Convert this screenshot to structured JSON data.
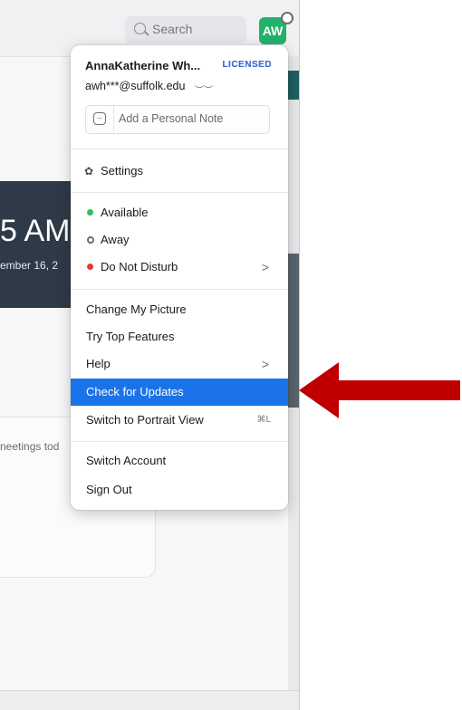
{
  "header": {
    "search_placeholder": "Search",
    "avatar_initials": "AW"
  },
  "background": {
    "clock_partial": "5 AM",
    "date_partial": "ember 16, 2",
    "meetings_partial": "neetings tod"
  },
  "menu": {
    "user_name": "AnnaKatherine Wh...",
    "license_badge": "LICENSED",
    "email": "awh***@suffolk.edu",
    "personal_note_placeholder": "Add a Personal Note",
    "settings": "Settings",
    "status": {
      "available": "Available",
      "away": "Away",
      "dnd": "Do Not Disturb",
      "dnd_chevron": ">"
    },
    "change_picture": "Change My Picture",
    "top_features": "Try Top Features",
    "help": "Help",
    "help_chevron": ">",
    "check_updates": "Check for Updates",
    "portrait_view": "Switch to Portrait View",
    "portrait_shortcut": "⌘L",
    "switch_account": "Switch Account",
    "sign_out": "Sign Out"
  },
  "colors": {
    "selected": "#1a73e8",
    "avatar": "#23b26b",
    "arrow": "#c00000",
    "available": "#2fbf5b",
    "dnd": "#e53935"
  }
}
